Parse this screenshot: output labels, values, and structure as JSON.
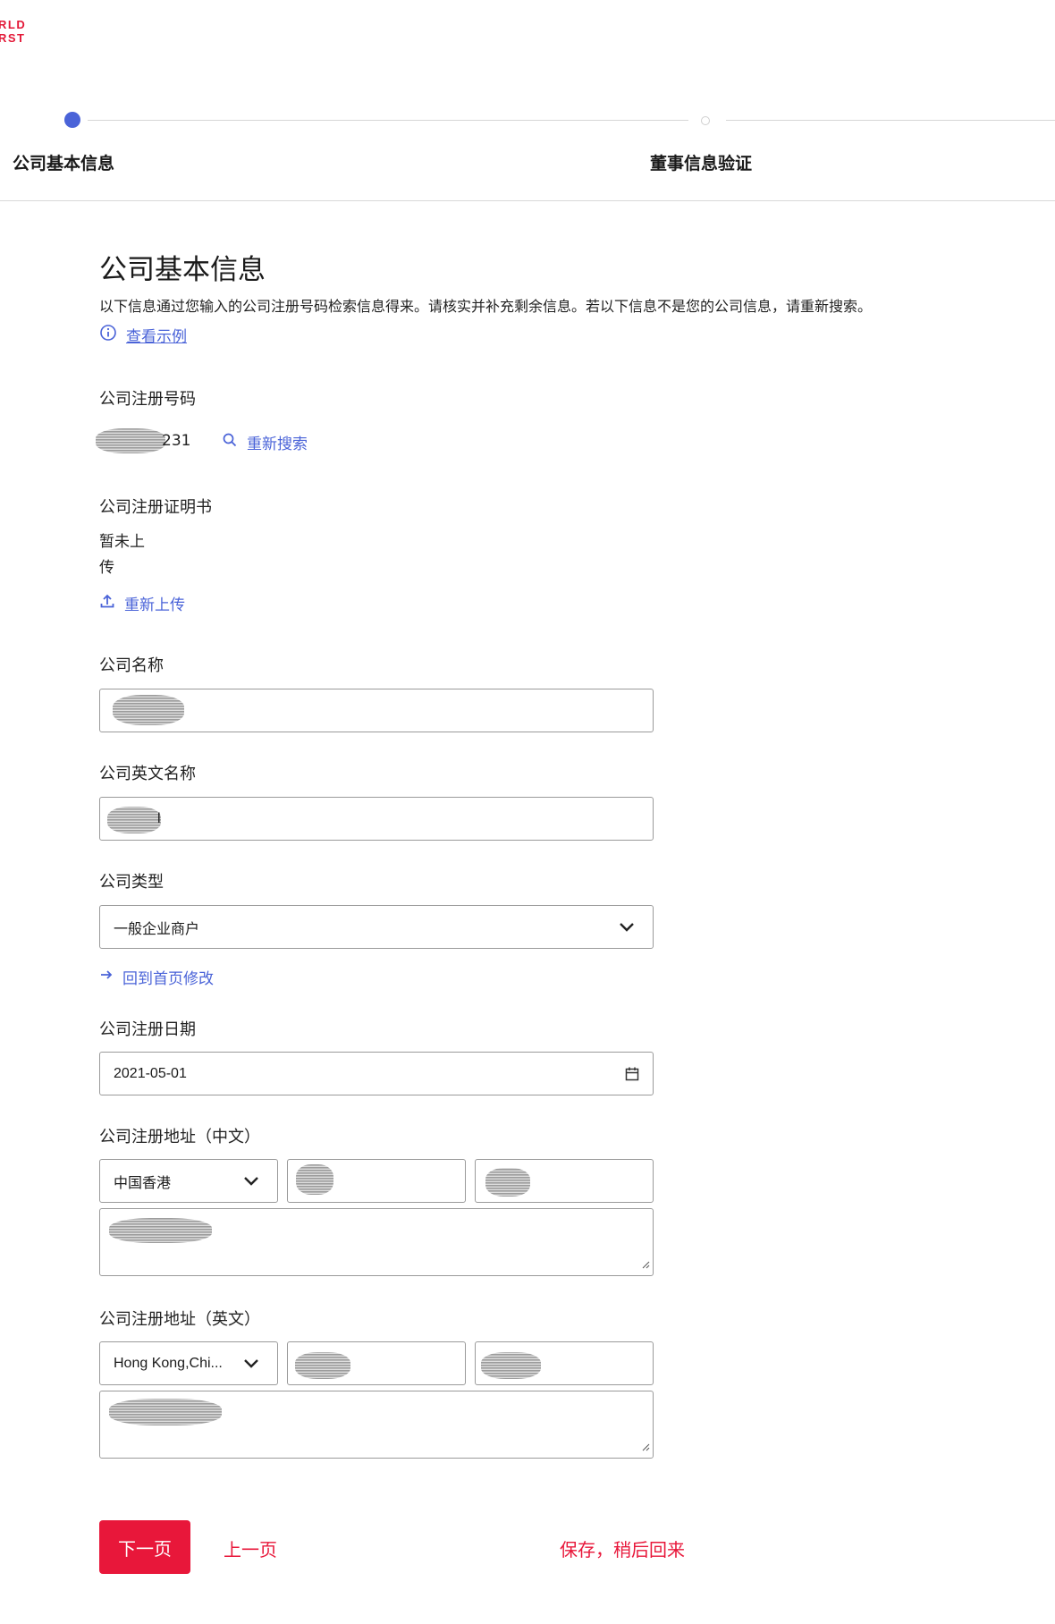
{
  "brand": {
    "logo_line1": "RLD",
    "logo_line2": "RST"
  },
  "stepper": {
    "steps": [
      {
        "label": "公司基本信息",
        "active": true
      },
      {
        "label": "董事信息验证",
        "active": false
      }
    ],
    "active_color": "#4a63d8"
  },
  "page": {
    "title": "公司基本信息",
    "description": "以下信息通过您输入的公司注册号码检索信息得来。请核实并补充剩余信息。若以下信息不是您的公司信息，请重新搜索。",
    "example_link": "查看示例"
  },
  "registration_number": {
    "label": "公司注册号码",
    "value_suffix": "231",
    "research_link": "重新搜索"
  },
  "certificate": {
    "label": "公司注册证明书",
    "status_line1": "暂未上",
    "status_line2": "传",
    "reupload_link": "重新上传"
  },
  "company_name": {
    "label": "公司名称"
  },
  "company_name_en": {
    "label": "公司英文名称",
    "value_suffix": "l"
  },
  "company_type": {
    "label": "公司类型",
    "selected": "一般企业商户",
    "back_link": "回到首页修改"
  },
  "registration_date": {
    "label": "公司注册日期",
    "value": "2021-05-01"
  },
  "address_cn": {
    "label": "公司注册地址（中文）",
    "region": "中国香港"
  },
  "address_en": {
    "label": "公司注册地址（英文）",
    "region": "Hong Kong,Chi..."
  },
  "actions": {
    "next": "下一页",
    "prev": "上一页",
    "save": "保存，稍后回来"
  },
  "colors": {
    "accent_blue": "#4a63d8",
    "brand_red": "#e8173a"
  },
  "icons": [
    "info-icon",
    "search-icon",
    "upload-icon",
    "arrow-right-icon",
    "chevron-down-icon",
    "calendar-icon",
    "resize-grip-icon"
  ]
}
